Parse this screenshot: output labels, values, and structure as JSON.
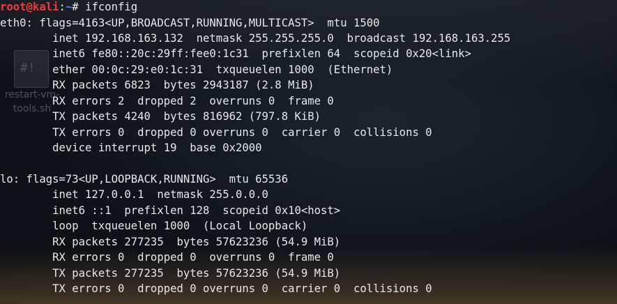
{
  "desktop_icon": {
    "glyph": "#!",
    "label_line1": "restart-vm-",
    "label_line2": "tools.sh"
  },
  "prompt": {
    "user_host": "root@kali",
    "separator": ":",
    "path": "~",
    "hash": "#",
    "command": "ifconfig"
  },
  "output": [
    "eth0: flags=4163<UP,BROADCAST,RUNNING,MULTICAST>  mtu 1500",
    "        inet 192.168.163.132  netmask 255.255.255.0  broadcast 192.168.163.255",
    "        inet6 fe80::20c:29ff:fee0:1c31  prefixlen 64  scopeid 0x20<link>",
    "        ether 00:0c:29:e0:1c:31  txqueuelen 1000  (Ethernet)",
    "        RX packets 6823  bytes 2943187 (2.8 MiB)",
    "        RX errors 2  dropped 2  overruns 0  frame 0",
    "        TX packets 4240  bytes 816962 (797.8 KiB)",
    "        TX errors 0  dropped 0 overruns 0  carrier 0  collisions 0",
    "        device interrupt 19  base 0x2000",
    "",
    "lo: flags=73<UP,LOOPBACK,RUNNING>  mtu 65536",
    "        inet 127.0.0.1  netmask 255.0.0.0",
    "        inet6 ::1  prefixlen 128  scopeid 0x10<host>",
    "        loop  txqueuelen 1000  (Local Loopback)",
    "        RX packets 277235  bytes 57623236 (54.9 MiB)",
    "        RX errors 0  dropped 0  overruns 0  frame 0",
    "        TX packets 277235  bytes 57623236 (54.9 MiB)",
    "        TX errors 0  dropped 0 overruns 0  carrier 0  collisions 0"
  ],
  "colors": {
    "prompt_user": "#ef3b3b",
    "prompt_path": "#4c7cf0",
    "text": "#e8e8e8"
  }
}
